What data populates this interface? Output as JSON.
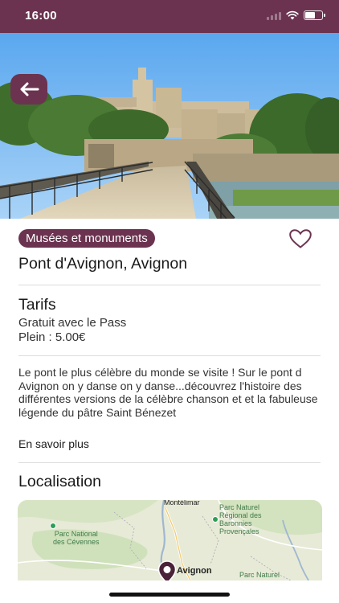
{
  "status_bar": {
    "time": "16:00",
    "battery_level": 0.6
  },
  "header": {
    "back_icon": "arrow-left-icon"
  },
  "hero": {
    "subject": "Pont d'Avignon photograph"
  },
  "place": {
    "category": "Musées et monuments",
    "title": "Pont d'Avignon, Avignon",
    "favorite_icon": "heart-outline-icon"
  },
  "tarifs": {
    "title": "Tarifs",
    "lines": [
      "Gratuit avec le Pass",
      "Plein : 5.00€"
    ]
  },
  "description": {
    "text": "Le pont le plus célèbre du monde se visite ! Sur le pont d Avignon on y danse on y danse...découvrez l'histoire des différentes versions de la célèbre chanson et et la fabuleuse légende du pâtre Saint Bénezet",
    "more_label": "En savoir plus"
  },
  "localisation": {
    "title": "Localisation",
    "map_labels": {
      "top_town": "Montélimar",
      "park_baronnies": "Parc Naturel\nRégional des\nBaronnies\nProvençales",
      "park_cevennes": "Parc National\ndes Cévennes",
      "city": "Avignon",
      "bottom_park": "Parc Naturel"
    }
  },
  "colors": {
    "brand": "#6b3350",
    "map_land": "#e8ecd8",
    "map_green": "#3f7b49"
  }
}
